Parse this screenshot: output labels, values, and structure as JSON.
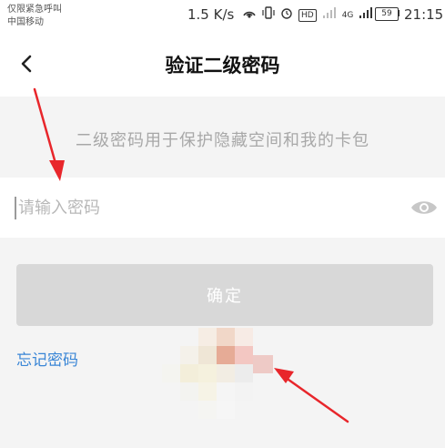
{
  "status_bar": {
    "carrier_line1": "仅限紧急呼叫",
    "carrier_line2": "中国移动",
    "speed": "1.5 K/s",
    "hd_badge": "HD",
    "network_badge": "4G",
    "battery_level": "59",
    "time": "21:15"
  },
  "nav": {
    "back_icon": "chevron-left-icon",
    "title": "验证二级密码"
  },
  "hint": "二级密码用于保护隐藏空间和我的卡包",
  "password_field": {
    "placeholder": "请输入密码",
    "value": "",
    "visibility_icon": "eye-icon"
  },
  "confirm_button": {
    "label": "确定"
  },
  "forgot_link": {
    "label": "忘记密码"
  },
  "colors": {
    "accent_link": "#3a86d6",
    "button_disabled": "#d8d8d8",
    "background": "#f4f4f4",
    "annotation_arrow": "#e8262b"
  }
}
